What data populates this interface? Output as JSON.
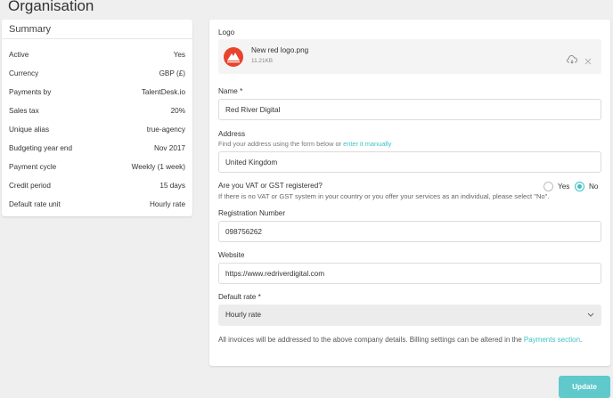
{
  "page": {
    "title": "Organisation"
  },
  "summary": {
    "title": "Summary",
    "rows": [
      {
        "key": "Active",
        "value": "Yes"
      },
      {
        "key": "Currency",
        "value": "GBP (£)"
      },
      {
        "key": "Payments by",
        "value": "TalentDesk.io"
      },
      {
        "key": "Sales tax",
        "value": "20%"
      },
      {
        "key": "Unique alias",
        "value": "true-agency"
      },
      {
        "key": "Budgeting year end",
        "value": "Nov 2017"
      },
      {
        "key": "Payment cycle",
        "value": "Weekly (1 week)"
      },
      {
        "key": "Credit period",
        "value": "15 days"
      },
      {
        "key": "Default rate unit",
        "value": "Hourly rate"
      }
    ]
  },
  "form": {
    "logo": {
      "label": "Logo",
      "file_name": "New red logo.png",
      "file_size": "11.21KB",
      "download_icon": "cloud-download-icon",
      "remove_icon": "close-icon",
      "logo_color": "#e8432d"
    },
    "name": {
      "label": "Name *",
      "value": "Red River Digital"
    },
    "address": {
      "label": "Address",
      "hint_prefix": "Find your address using the form below or ",
      "hint_link": "enter it manually",
      "value": "United Kingdom"
    },
    "vat": {
      "label": "Are you VAT or GST registered?",
      "hint": "If there is no VAT or GST system in your country or you offer your services as an individual, please select \"No\".",
      "option_yes": "Yes",
      "option_no": "No",
      "selected": "No"
    },
    "registration": {
      "label": "Registration Number",
      "value": "098756262"
    },
    "website": {
      "label": "Website",
      "value": "https://www.redriverdigital.com"
    },
    "default_rate": {
      "label": "Default rate *",
      "value": "Hourly rate"
    },
    "footnote_prefix": "All invoices will be addressed to the above company details. Billing settings can be altered in the ",
    "footnote_link": "Payments section",
    "footnote_suffix": "."
  },
  "actions": {
    "update_label": "Update"
  },
  "colors": {
    "accent": "#3dc1c5",
    "button": "#5fc9cc"
  }
}
